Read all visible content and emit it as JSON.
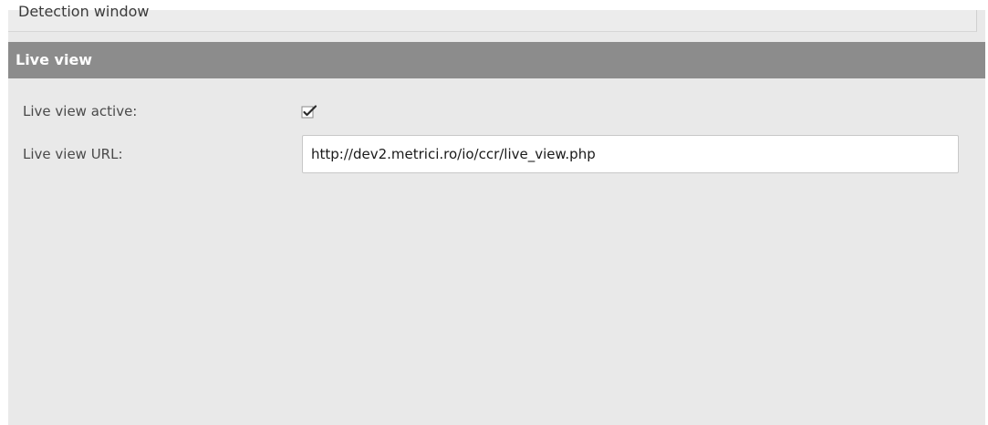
{
  "sections": {
    "detection_window": {
      "title": "Detection window"
    },
    "live_view": {
      "title": "Live view"
    }
  },
  "live_view": {
    "active_label": "Live view active:",
    "active_checked": true,
    "url_label": "Live view URL:",
    "url_value": "http://dev2.metrici.ro/io/ccr/live_view.php"
  },
  "icons": {
    "checkbox": "check-icon"
  },
  "colors": {
    "panel_bg": "#e9e9e9",
    "active_header_bg": "#8c8c8c",
    "active_header_text": "#ffffff",
    "label_text": "#4a4a4a"
  }
}
